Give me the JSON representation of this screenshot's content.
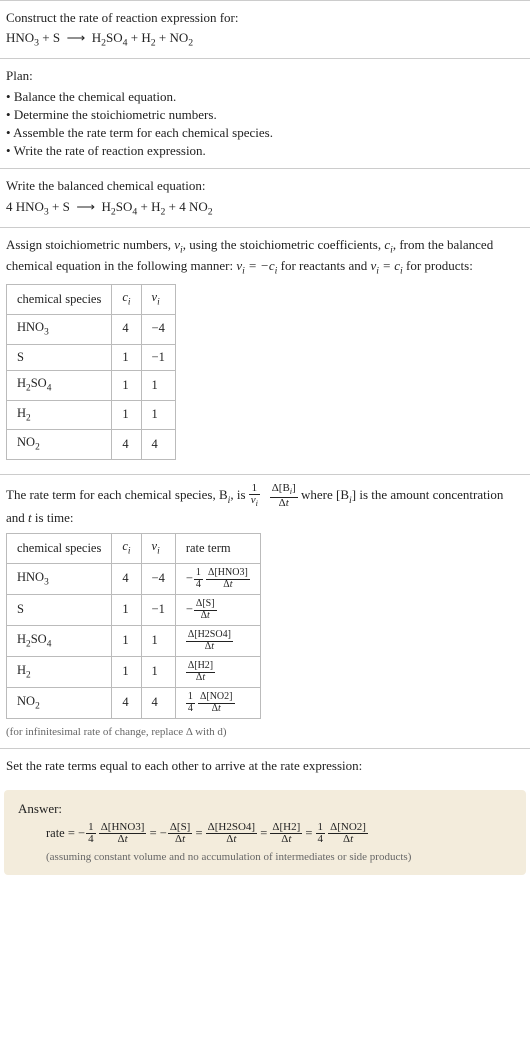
{
  "intro": {
    "line1": "Construct the rate of reaction expression for:",
    "eq": "HNO_3 + S ⟶ H_2SO_4 + H_2 + NO_2"
  },
  "plan": {
    "heading": "Plan:",
    "items": [
      "Balance the chemical equation.",
      "Determine the stoichiometric numbers.",
      "Assemble the rate term for each chemical species.",
      "Write the rate of reaction expression."
    ]
  },
  "balanced": {
    "heading": "Write the balanced chemical equation:",
    "eq": "4 HNO_3 + S ⟶ H_2SO_4 + H_2 + 4 NO_2"
  },
  "stoich": {
    "text_a": "Assign stoichiometric numbers, ",
    "nu_i": "ν_i",
    "text_b": ", using the stoichiometric coefficients, ",
    "c_i": "c_i",
    "text_c": ", from the balanced chemical equation in the following manner: ",
    "rel_react": "ν_i = −c_i",
    "text_d": " for reactants and ",
    "rel_prod": "ν_i = c_i",
    "text_e": " for products:",
    "table": {
      "headers": [
        "chemical species",
        "c_i",
        "ν_i"
      ],
      "rows": [
        {
          "sp": "HNO_3",
          "c": "4",
          "nu": "−4"
        },
        {
          "sp": "S",
          "c": "1",
          "nu": "−1"
        },
        {
          "sp": "H_2SO_4",
          "c": "1",
          "nu": "1"
        },
        {
          "sp": "H_2",
          "c": "1",
          "nu": "1"
        },
        {
          "sp": "NO_2",
          "c": "4",
          "nu": "4"
        }
      ]
    }
  },
  "rateterm": {
    "text_a": "The rate term for each chemical species, ",
    "B_i": "B_i",
    "text_b": ", is ",
    "text_c": " where ",
    "brack_Bi": "[B_i]",
    "text_d": " is the amount concentration and ",
    "t": "t",
    "text_e": " is time:",
    "frac_left_num": "1",
    "frac_left_den": "ν_i",
    "frac_right_num": "Δ[B_i]",
    "frac_right_den": "Δt",
    "table": {
      "headers": [
        "chemical species",
        "c_i",
        "ν_i",
        "rate term"
      ],
      "rows": [
        {
          "sp": "HNO_3",
          "c": "4",
          "nu": "−4",
          "sign": "−",
          "coef_num": "1",
          "coef_den": "4",
          "conc": "Δ[HNO3]"
        },
        {
          "sp": "S",
          "c": "1",
          "nu": "−1",
          "sign": "−",
          "coef_num": "",
          "coef_den": "",
          "conc": "Δ[S]"
        },
        {
          "sp": "H_2SO_4",
          "c": "1",
          "nu": "1",
          "sign": "",
          "coef_num": "",
          "coef_den": "",
          "conc": "Δ[H2SO4]"
        },
        {
          "sp": "H_2",
          "c": "1",
          "nu": "1",
          "sign": "",
          "coef_num": "",
          "coef_den": "",
          "conc": "Δ[H2]"
        },
        {
          "sp": "NO_2",
          "c": "4",
          "nu": "4",
          "sign": "",
          "coef_num": "1",
          "coef_den": "4",
          "conc": "Δ[NO2]"
        }
      ]
    },
    "note": "(for infinitesimal rate of change, replace Δ with d)"
  },
  "final": {
    "heading": "Set the rate terms equal to each other to arrive at the rate expression:",
    "answer_label": "Answer:",
    "rate_prefix": "rate = ",
    "terms": [
      {
        "sign": "−",
        "coef_num": "1",
        "coef_den": "4",
        "conc": "Δ[HNO3]"
      },
      {
        "sign": "−",
        "coef_num": "",
        "coef_den": "",
        "conc": "Δ[S]"
      },
      {
        "sign": "",
        "coef_num": "",
        "coef_den": "",
        "conc": "Δ[H2SO4]"
      },
      {
        "sign": "",
        "coef_num": "",
        "coef_den": "",
        "conc": "Δ[H2]"
      },
      {
        "sign": "",
        "coef_num": "1",
        "coef_den": "4",
        "conc": "Δ[NO2]"
      }
    ],
    "dt": "Δt",
    "assume": "(assuming constant volume and no accumulation of intermediates or side products)"
  },
  "chart_data": {
    "type": "table",
    "title": "Stoichiometric numbers and rate terms",
    "tables": [
      {
        "columns": [
          "chemical species",
          "c_i",
          "nu_i"
        ],
        "rows": [
          [
            "HNO3",
            4,
            -4
          ],
          [
            "S",
            1,
            -1
          ],
          [
            "H2SO4",
            1,
            1
          ],
          [
            "H2",
            1,
            1
          ],
          [
            "NO2",
            4,
            4
          ]
        ]
      },
      {
        "columns": [
          "chemical species",
          "c_i",
          "nu_i",
          "rate term"
        ],
        "rows": [
          [
            "HNO3",
            4,
            -4,
            "-(1/4) d[HNO3]/dt"
          ],
          [
            "S",
            1,
            -1,
            "- d[S]/dt"
          ],
          [
            "H2SO4",
            1,
            1,
            "d[H2SO4]/dt"
          ],
          [
            "H2",
            1,
            1,
            "d[H2]/dt"
          ],
          [
            "NO2",
            4,
            4,
            "(1/4) d[NO2]/dt"
          ]
        ]
      }
    ],
    "rate_expression": "rate = -(1/4) d[HNO3]/dt = - d[S]/dt = d[H2SO4]/dt = d[H2]/dt = (1/4) d[NO2]/dt"
  }
}
